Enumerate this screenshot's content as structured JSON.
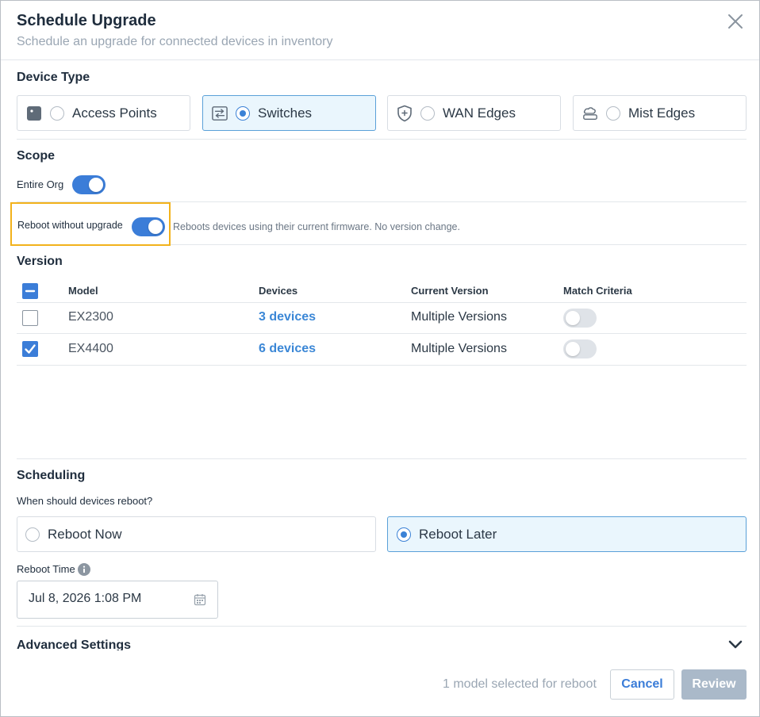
{
  "header": {
    "title": "Schedule Upgrade",
    "subtitle": "Schedule an upgrade for connected devices in inventory"
  },
  "device_type": {
    "heading": "Device Type",
    "options": [
      {
        "label": "Access Points",
        "icon": "access-point-icon",
        "selected": false
      },
      {
        "label": "Switches",
        "icon": "switch-icon",
        "selected": true
      },
      {
        "label": "WAN Edges",
        "icon": "wan-edge-shield-icon",
        "selected": false
      },
      {
        "label": "Mist Edges",
        "icon": "mist-edge-cloud-icon",
        "selected": false
      }
    ]
  },
  "scope": {
    "heading": "Scope",
    "entire_org_label": "Entire Org",
    "entire_org_on": true,
    "reboot_label": "Reboot without upgrade",
    "reboot_on": true,
    "reboot_description": "Reboots devices using their current firmware. No version change."
  },
  "version": {
    "heading": "Version",
    "columns": [
      "Model",
      "Devices",
      "Current Version",
      "Match Criteria"
    ],
    "rows": [
      {
        "model": "EX2300",
        "devices": "3 devices",
        "current_version": "Multiple Versions",
        "checked": false,
        "match": false
      },
      {
        "model": "EX4400",
        "devices": "6 devices",
        "current_version": "Multiple Versions",
        "checked": true,
        "match": false
      }
    ]
  },
  "scheduling": {
    "heading": "Scheduling",
    "question": "When should devices reboot?",
    "options": [
      {
        "label": "Reboot Now",
        "selected": false
      },
      {
        "label": "Reboot Later",
        "selected": true
      }
    ],
    "reboot_time_label": "Reboot Time",
    "reboot_time_value": "Jul 8, 2026 1:08 PM"
  },
  "advanced": {
    "heading": "Advanced Settings"
  },
  "footer": {
    "summary": "1 model selected for reboot",
    "cancel_label": "Cancel",
    "review_label": "Review"
  },
  "colors": {
    "accent": "#3b7dd8",
    "link": "#3b87d6",
    "highlight": "#f2b21b",
    "selected_bg": "#eaf6fd",
    "review_disabled": "#aab9c9"
  }
}
